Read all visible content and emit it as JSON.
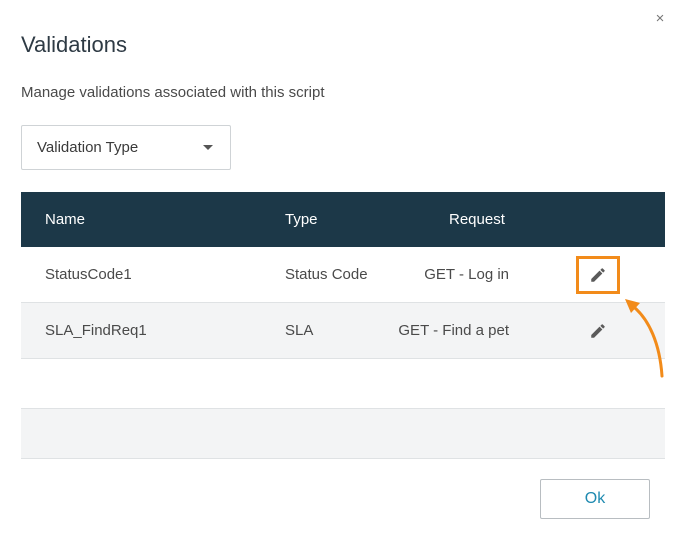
{
  "dialog": {
    "title": "Validations",
    "subtitle": "Manage validations associated with this script",
    "close_label": "×"
  },
  "filter": {
    "selected": "Validation Type"
  },
  "table": {
    "headers": {
      "name": "Name",
      "type": "Type",
      "request": "Request"
    },
    "rows": [
      {
        "name": "StatusCode1",
        "type": "Status Code",
        "request": "GET - Log in",
        "action_icon": "pencil-icon",
        "highlighted": true
      },
      {
        "name": "SLA_FindReq1",
        "type": "SLA",
        "request": "GET - Find a pet",
        "action_icon": "pencil-icon",
        "highlighted": false
      }
    ]
  },
  "footer": {
    "ok_label": "Ok"
  },
  "colors": {
    "header_bg": "#1c3848",
    "highlight": "#f28b1a",
    "ok_text": "#1f8ab0"
  }
}
